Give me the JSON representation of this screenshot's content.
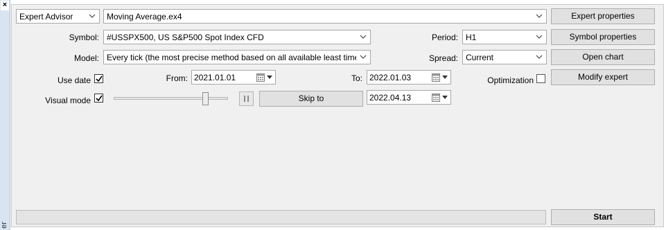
{
  "dock": {
    "close_label": "×",
    "vertical_label": "er"
  },
  "expert": {
    "type_value": "Expert Advisor",
    "file_value": "Moving Average.ex4"
  },
  "symbol": {
    "label": "Symbol:",
    "value": "#USSPX500, US S&P500 Spot Index CFD"
  },
  "model": {
    "label": "Model:",
    "value": "Every tick (the most precise method based on all available least timeframes to"
  },
  "period": {
    "label": "Period:",
    "value": "H1"
  },
  "spread": {
    "label": "Spread:",
    "value": "Current"
  },
  "use_date": {
    "label": "Use date",
    "checked": true
  },
  "from": {
    "label": "From:",
    "value": "2021.01.01"
  },
  "to": {
    "label": "To:",
    "value": "2022.01.03"
  },
  "optimization": {
    "label": "Optimization",
    "checked": false
  },
  "visual_mode": {
    "label": "Visual mode",
    "checked": true,
    "speed_level": 0.82
  },
  "skip_to": {
    "button_label": "Skip to",
    "value": "2022.04.13"
  },
  "buttons": {
    "expert_properties": "Expert properties",
    "symbol_properties": "Symbol properties",
    "open_chart": "Open chart",
    "modify_expert": "Modify expert",
    "start": "Start"
  },
  "progress": {
    "fraction": 0
  },
  "colors": {
    "progress_fill": "#06b025",
    "panel_bg": "#f0f0f0",
    "dock_bg": "#d9e4f1"
  },
  "icons": {
    "combo_arrow": "chevron-down-icon",
    "calendar": "calendar-icon",
    "pause": "pause-icon",
    "check": "checkmark-icon"
  }
}
